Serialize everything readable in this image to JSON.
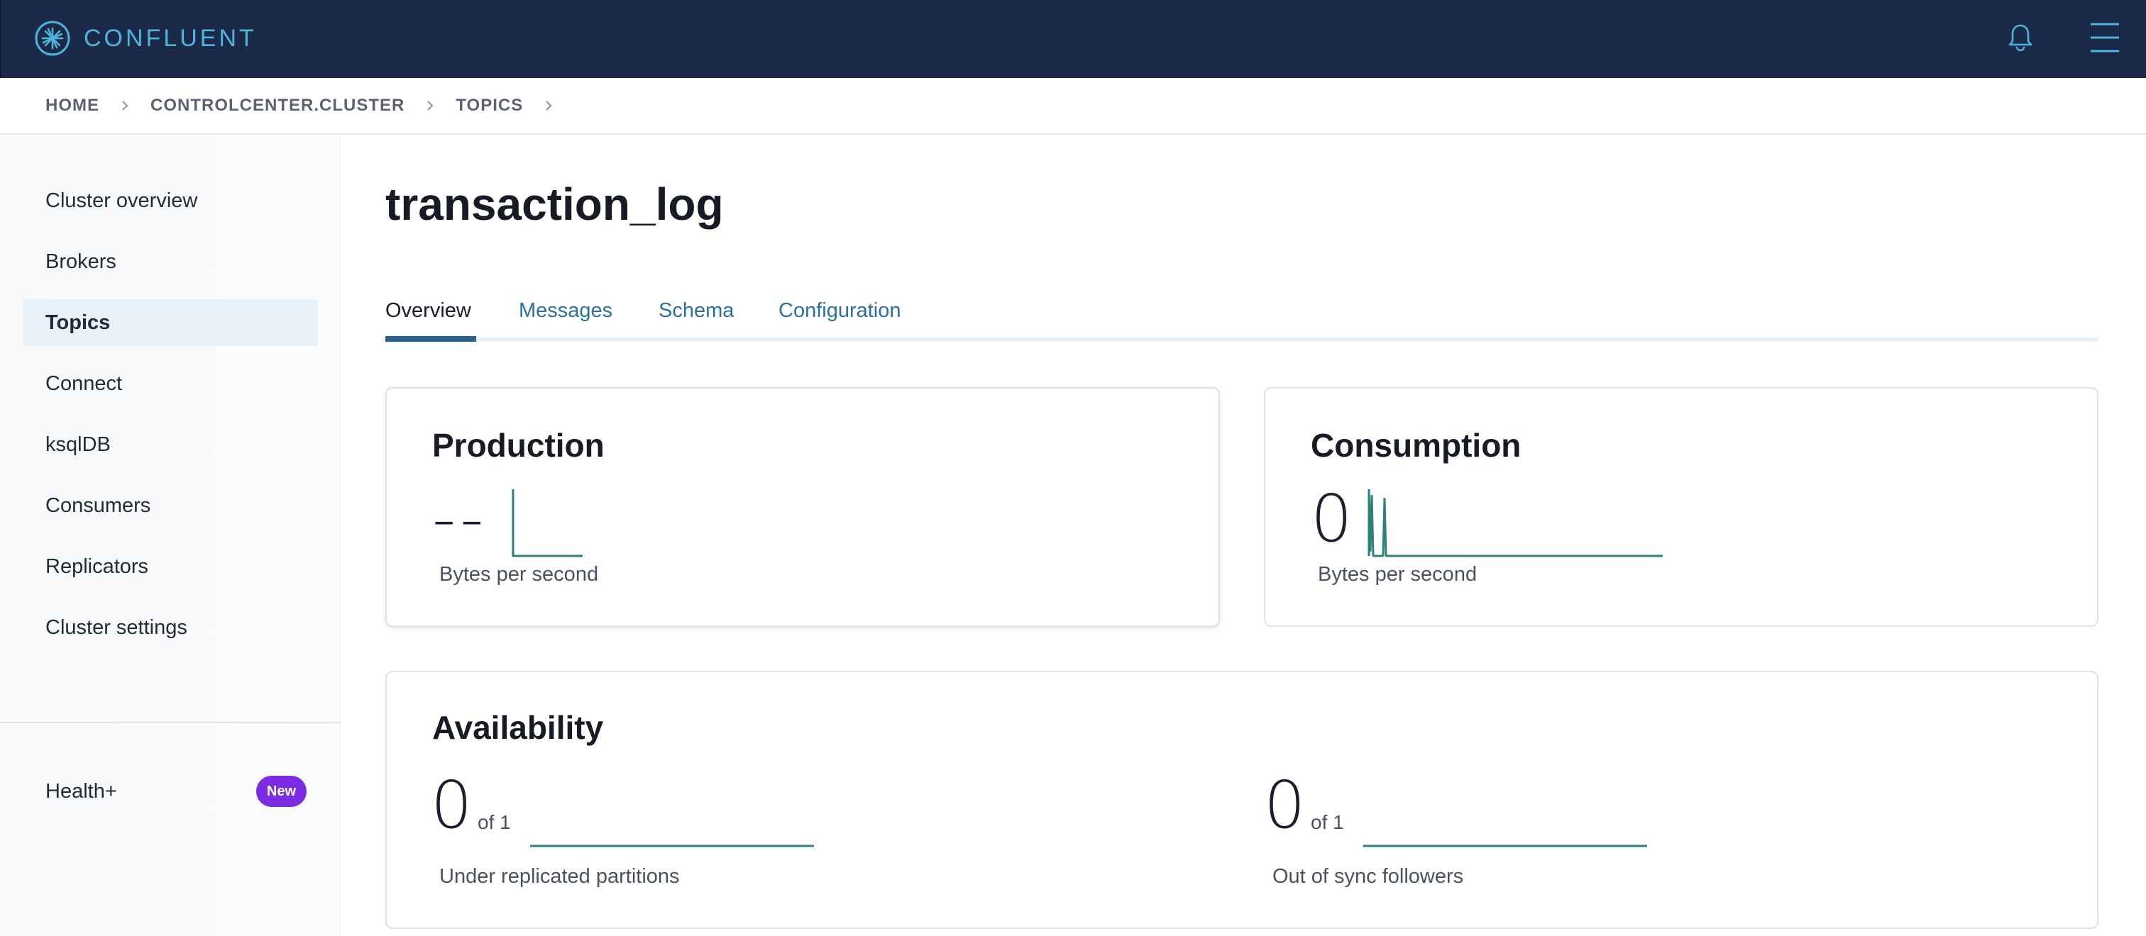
{
  "app": {
    "brand": "CONFLUENT",
    "icons": {
      "logo": "confluent-logo-icon",
      "bell": "bell-icon",
      "menu": "hamburger-menu-icon",
      "chevron": "chevron-right-icon"
    }
  },
  "breadcrumb": [
    "HOME",
    "CONTROLCENTER.CLUSTER",
    "TOPICS"
  ],
  "sidebar": {
    "items": [
      {
        "label": "Cluster overview",
        "active": false
      },
      {
        "label": "Brokers",
        "active": false
      },
      {
        "label": "Topics",
        "active": true
      },
      {
        "label": "Connect",
        "active": false
      },
      {
        "label": "ksqlDB",
        "active": false
      },
      {
        "label": "Consumers",
        "active": false
      },
      {
        "label": "Replicators",
        "active": false
      },
      {
        "label": "Cluster settings",
        "active": false
      }
    ],
    "health": {
      "label": "Health+",
      "badge": "New"
    }
  },
  "page": {
    "title": "transaction_log",
    "tabs": [
      {
        "label": "Overview",
        "active": true
      },
      {
        "label": "Messages",
        "active": false
      },
      {
        "label": "Schema",
        "active": false
      },
      {
        "label": "Configuration",
        "active": false
      }
    ]
  },
  "production": {
    "title": "Production",
    "value": "--",
    "label": "Bytes per second"
  },
  "consumption": {
    "title": "Consumption",
    "value": "0",
    "label": "Bytes per second"
  },
  "availability": {
    "title": "Availability",
    "under_replicated": {
      "value": "0",
      "of": "of 1",
      "label": "Under replicated partitions"
    },
    "out_of_sync": {
      "value": "0",
      "of": "of 1",
      "label": "Out of sync followers"
    }
  },
  "colors": {
    "topbar": "#1c2a4a",
    "brand": "#4fb4dc",
    "link": "#2d6f9e",
    "active_nav": "#e6f1fa",
    "badge": "#7b2be2",
    "sparkline": "#2f7f7a"
  }
}
